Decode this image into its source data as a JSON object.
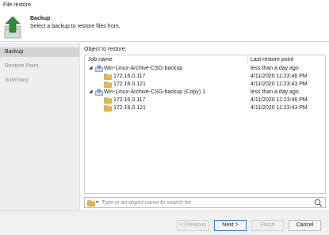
{
  "window": {
    "title": "File restore"
  },
  "header": {
    "title": "Backup",
    "subtitle": "Select a backup to restore files from."
  },
  "sidebar": {
    "items": [
      {
        "label": "Backup",
        "active": true
      },
      {
        "label": "Restore Point",
        "active": false
      },
      {
        "label": "Summary",
        "active": false
      }
    ]
  },
  "main": {
    "object_label": "Object to restore:",
    "columns": {
      "job": "Job name",
      "last": "Last restore point"
    },
    "rows": [
      {
        "name": "Win-Linux-Archive-CSG-backup",
        "date": "less than a day ago",
        "level": 0,
        "type": "job",
        "expanded": true
      },
      {
        "name": "172.16.0.117",
        "date": "4/11/2020 11:23:46 PM",
        "level": 1,
        "type": "host"
      },
      {
        "name": "172.16.0.121",
        "date": "4/11/2020 11:23:43 PM",
        "level": 1,
        "type": "host"
      },
      {
        "name": "Win-Linux-Archive-CSG-backup (Copy) 1",
        "date": "less than a day ago",
        "level": 0,
        "type": "job",
        "expanded": true
      },
      {
        "name": "172.16.0.117",
        "date": "4/11/2020 11:23:46 PM",
        "level": 1,
        "type": "host"
      },
      {
        "name": "172.16.0.121",
        "date": "4/11/2020 11:23:43 PM",
        "level": 1,
        "type": "host"
      }
    ],
    "search_placeholder": "Type in an object name to search for"
  },
  "footer": {
    "previous": "< Previous",
    "next": "Next >",
    "finish": "Finish",
    "cancel": "Cancel"
  },
  "colors": {
    "accent": "#3a7bd5",
    "folder": "#e8b54a",
    "arrow": "#2f8a3a"
  },
  "icons": {
    "header": "backup-restore-arrow-icon",
    "job": "backup-job-icon",
    "host": "folder-icon",
    "search": "search-icon"
  }
}
